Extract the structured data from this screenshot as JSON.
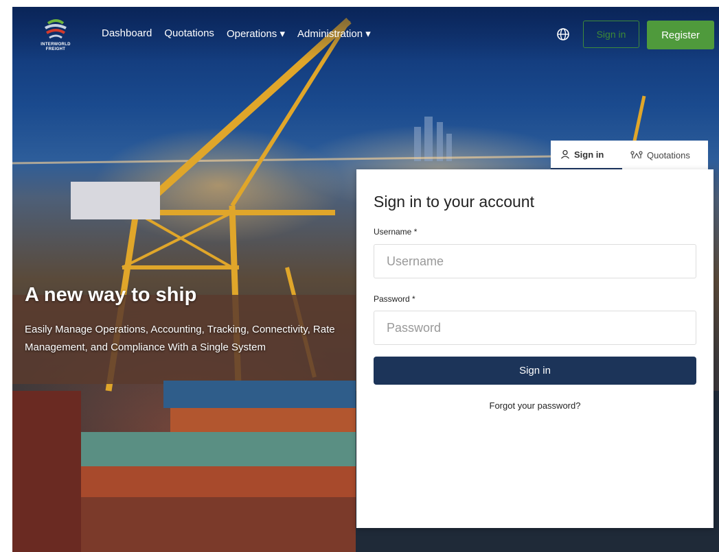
{
  "nav": {
    "logo_text": "INTERWORLD FREIGHT",
    "links": [
      "Dashboard",
      "Quotations",
      "Operations ▾",
      "Administration ▾"
    ],
    "globe_icon": "globe-icon",
    "signin_label": "Sign in",
    "register_label": "Register"
  },
  "hero": {
    "title": "A new way to ship",
    "subtitle": "Easily Manage Operations, Accounting, Tracking, Connectivity, Rate Management, and Compliance With a Single System"
  },
  "tabs": [
    {
      "label": "Sign in",
      "icon": "user-icon"
    },
    {
      "label": "Quotations",
      "icon": "route-icon"
    }
  ],
  "form": {
    "title": "Sign in to your account",
    "username_label": "Username *",
    "username_placeholder": "Username",
    "password_label": "Password *",
    "password_placeholder": "Password",
    "submit_label": "Sign in",
    "forgot_label": "Forgot your password?"
  },
  "colors": {
    "primary": "#1c3459",
    "register": "#4f9a3c",
    "signin_outline": "#3f8b3a"
  }
}
